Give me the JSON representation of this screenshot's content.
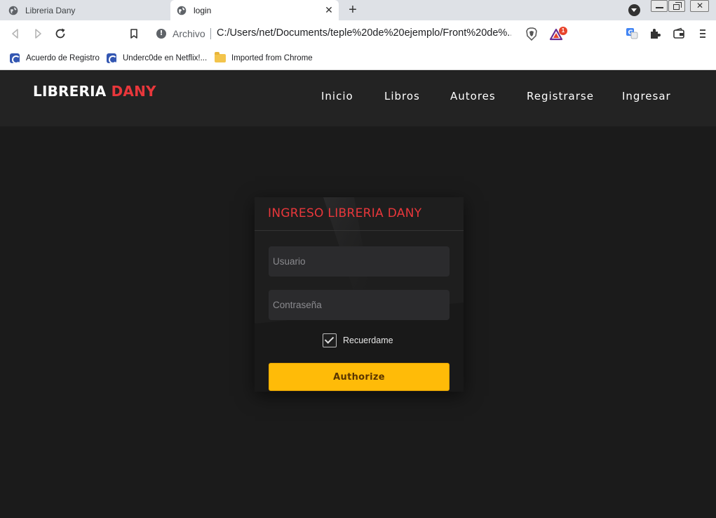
{
  "browser": {
    "tabs": [
      {
        "title": "Libreria Dany",
        "active": false
      },
      {
        "title": "login",
        "active": true
      }
    ],
    "new_tab_label": "+",
    "address": {
      "scheme_label": "Archivo",
      "url": "C:/Users/net/Documents/teple%20de%20ejemplo/Front%20de%..."
    },
    "bookmarks": [
      "Acuerdo de Registro",
      "Underc0de en Netflix!...",
      "Imported from Chrome"
    ],
    "brave_badge_count": "1",
    "colors": {
      "tabstrip": "#dee1e6",
      "toolbar": "#ffffff",
      "brave_rewards_badge": "#e8432b"
    }
  },
  "site": {
    "logo": {
      "primary": "LIBRERIA",
      "accent": "DANY"
    },
    "nav": [
      "Inicio",
      "Libros",
      "Autores",
      "Registrarse",
      "Ingresar"
    ],
    "colors": {
      "background": "#1b1b1b",
      "header": "#232323",
      "accent": "#e8373b",
      "button": "#ffbb08"
    }
  },
  "login": {
    "title": "INGRESO LIBRERIA DANY",
    "username_placeholder": "Usuario",
    "password_placeholder": "Contraseña",
    "remember_label": "Recuerdame",
    "remember_checked": true,
    "submit_label": "Authorize"
  }
}
